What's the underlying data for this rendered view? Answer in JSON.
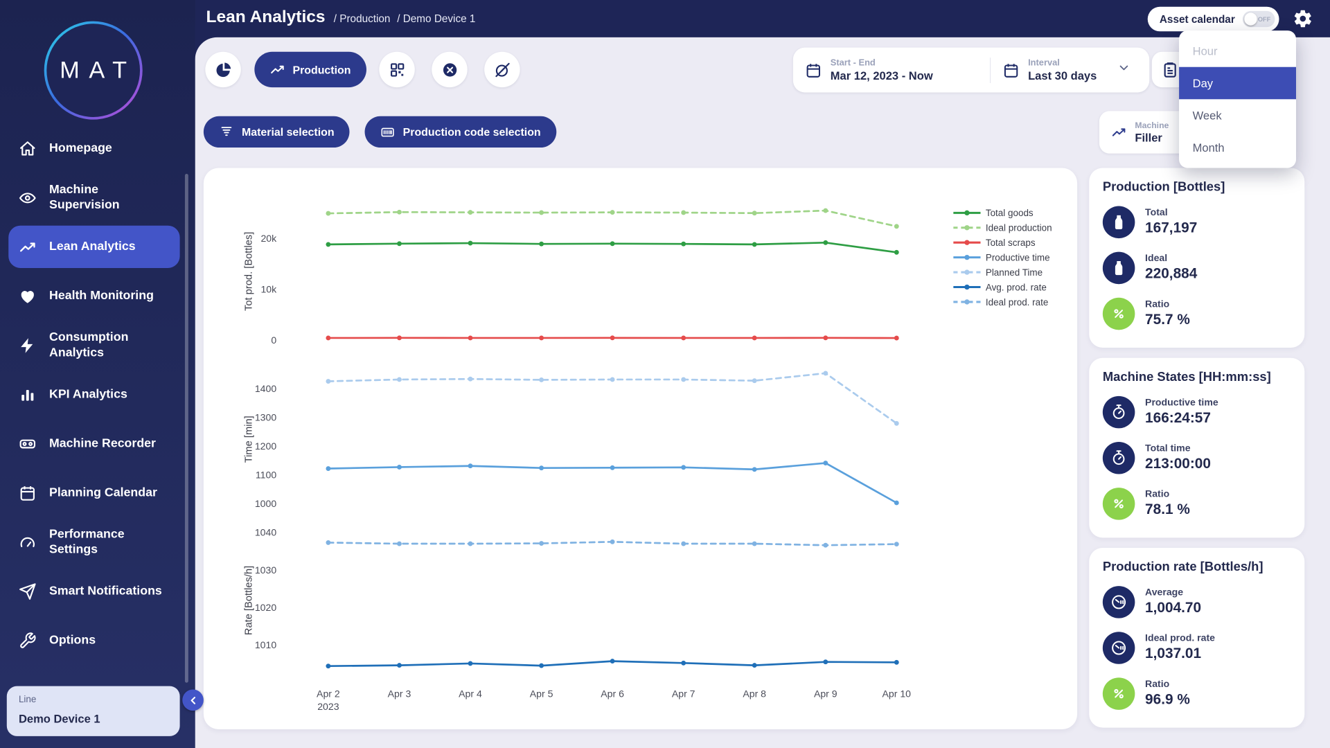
{
  "header": {
    "title": "Lean Analytics",
    "breadcrumb": [
      "Production",
      "Demo Device 1"
    ],
    "asset_calendar_label": "Asset calendar",
    "asset_calendar_state": "OFF"
  },
  "sidebar": {
    "logo": "MAT",
    "items": [
      {
        "label": "Homepage",
        "icon": "home",
        "active": false
      },
      {
        "label": "Machine Supervision",
        "icon": "eye",
        "active": false
      },
      {
        "label": "Lean Analytics",
        "icon": "trend",
        "active": true
      },
      {
        "label": "Health Monitoring",
        "icon": "heart",
        "active": false
      },
      {
        "label": "Consumption Analytics",
        "icon": "bolt",
        "active": false
      },
      {
        "label": "KPI Analytics",
        "icon": "bars",
        "active": false
      },
      {
        "label": "Machine Recorder",
        "icon": "recorder",
        "active": false
      },
      {
        "label": "Planning Calendar",
        "icon": "calendar",
        "active": false
      },
      {
        "label": "Performance Settings",
        "icon": "gauge",
        "active": false
      },
      {
        "label": "Smart Notifications",
        "icon": "send",
        "active": false
      },
      {
        "label": "Options",
        "icon": "wrench",
        "active": false
      }
    ],
    "device_card": {
      "label": "Line",
      "value": "Demo Device 1"
    }
  },
  "toolbar": {
    "production_label": "Production",
    "material_selection_label": "Material selection",
    "production_code_label": "Production code selection",
    "date_range": {
      "label": "Start - End",
      "value": "Mar 12, 2023 - Now"
    },
    "interval": {
      "label": "Interval",
      "value": "Last 30 days"
    },
    "machine_filter": {
      "label": "Machine",
      "value": "Filler"
    }
  },
  "interval_dropdown": {
    "options": [
      {
        "label": "Hour",
        "state": "disabled"
      },
      {
        "label": "Day",
        "state": "selected"
      },
      {
        "label": "Week",
        "state": "normal"
      },
      {
        "label": "Month",
        "state": "normal"
      }
    ]
  },
  "stats_cards": [
    {
      "title": "Production [Bottles]",
      "rows": [
        {
          "label": "Total",
          "value": "167,197",
          "icon": "bottle",
          "icon_color": "navy"
        },
        {
          "label": "Ideal",
          "value": "220,884",
          "icon": "bottle",
          "icon_color": "navy"
        },
        {
          "label": "Ratio",
          "value": "75.7 %",
          "icon": "ratio",
          "icon_color": "green"
        }
      ]
    },
    {
      "title": "Machine States [HH:mm:ss]",
      "rows": [
        {
          "label": "Productive time",
          "value": "166:24:57",
          "icon": "stopwatch",
          "icon_color": "navy"
        },
        {
          "label": "Total time",
          "value": "213:00:00",
          "icon": "stopwatch",
          "icon_color": "navy"
        },
        {
          "label": "Ratio",
          "value": "78.1 %",
          "icon": "ratio",
          "icon_color": "green"
        }
      ]
    },
    {
      "title": "Production rate [Bottles/h]",
      "rows": [
        {
          "label": "Average",
          "value": "1,004.70",
          "icon": "ratemeter",
          "icon_color": "navy"
        },
        {
          "label": "Ideal prod. rate",
          "value": "1,037.01",
          "icon": "ratemeter",
          "icon_color": "navy"
        },
        {
          "label": "Ratio",
          "value": "96.9 %",
          "icon": "ratio",
          "icon_color": "green"
        }
      ]
    }
  ],
  "chart_data": {
    "type": "line",
    "x_labels": [
      "Apr 2|2023",
      "Apr 3",
      "Apr 4",
      "Apr 5",
      "Apr 6",
      "Apr 7",
      "Apr 8",
      "Apr 9",
      "Apr 10"
    ],
    "grid": false,
    "legend_position": "top-right",
    "subplots": [
      {
        "ylabel": "Tot prod. [Bottles]",
        "ymin": 0,
        "ymax": 27000,
        "yticks": [
          {
            "v": 0,
            "t": "0"
          },
          {
            "v": 10000,
            "t": "10k"
          },
          {
            "v": 20000,
            "t": "20k"
          }
        ]
      },
      {
        "ylabel": "Time [min]",
        "ymin": 985,
        "ymax": 1465,
        "yticks": [
          {
            "v": 1000,
            "t": "1000"
          },
          {
            "v": 1100,
            "t": "1100"
          },
          {
            "v": 1200,
            "t": "1200"
          },
          {
            "v": 1300,
            "t": "1300"
          },
          {
            "v": 1400,
            "t": "1400"
          }
        ]
      },
      {
        "ylabel": "Rate [Bottles/h]",
        "ymin": 1002,
        "ymax": 1042,
        "yticks": [
          {
            "v": 1010,
            "t": "1010"
          },
          {
            "v": 1020,
            "t": "1020"
          },
          {
            "v": 1030,
            "t": "1030"
          },
          {
            "v": 1040,
            "t": "1040"
          }
        ]
      }
    ],
    "series": [
      {
        "name": "Total goods",
        "subplot": 0,
        "color": "#2e9e44",
        "dashed": false,
        "values": [
          18800,
          18950,
          19050,
          18900,
          18950,
          18900,
          18800,
          19150,
          17250
        ]
      },
      {
        "name": "Ideal production",
        "subplot": 0,
        "color": "#9fd488",
        "dashed": true,
        "values": [
          24900,
          25150,
          25100,
          25050,
          25100,
          25050,
          24950,
          25450,
          22350
        ]
      },
      {
        "name": "Total scraps",
        "subplot": 0,
        "color": "#e54b4b",
        "dashed": false,
        "values": [
          420,
          430,
          420,
          420,
          430,
          420,
          420,
          440,
          400
        ]
      },
      {
        "name": "Productive time",
        "subplot": 1,
        "color": "#5aa0dc",
        "dashed": false,
        "values": [
          1122,
          1127,
          1131,
          1124,
          1125,
          1126,
          1119,
          1141,
          1003
        ]
      },
      {
        "name": "Planned Time",
        "subplot": 1,
        "color": "#aacbed",
        "dashed": true,
        "values": [
          1425,
          1431,
          1433,
          1430,
          1431,
          1431,
          1427,
          1453,
          1279
        ]
      },
      {
        "name": "Avg. prod. rate",
        "subplot": 2,
        "color": "#1f6fb8",
        "dashed": false,
        "values": [
          1004.4,
          1004.6,
          1005.1,
          1004.5,
          1005.7,
          1005.2,
          1004.6,
          1005.5,
          1005.4
        ]
      },
      {
        "name": "Ideal prod. rate",
        "subplot": 2,
        "color": "#7fb2e2",
        "dashed": true,
        "values": [
          1037.3,
          1037.0,
          1037.0,
          1037.1,
          1037.5,
          1037.0,
          1037.0,
          1036.6,
          1036.9
        ]
      }
    ]
  }
}
